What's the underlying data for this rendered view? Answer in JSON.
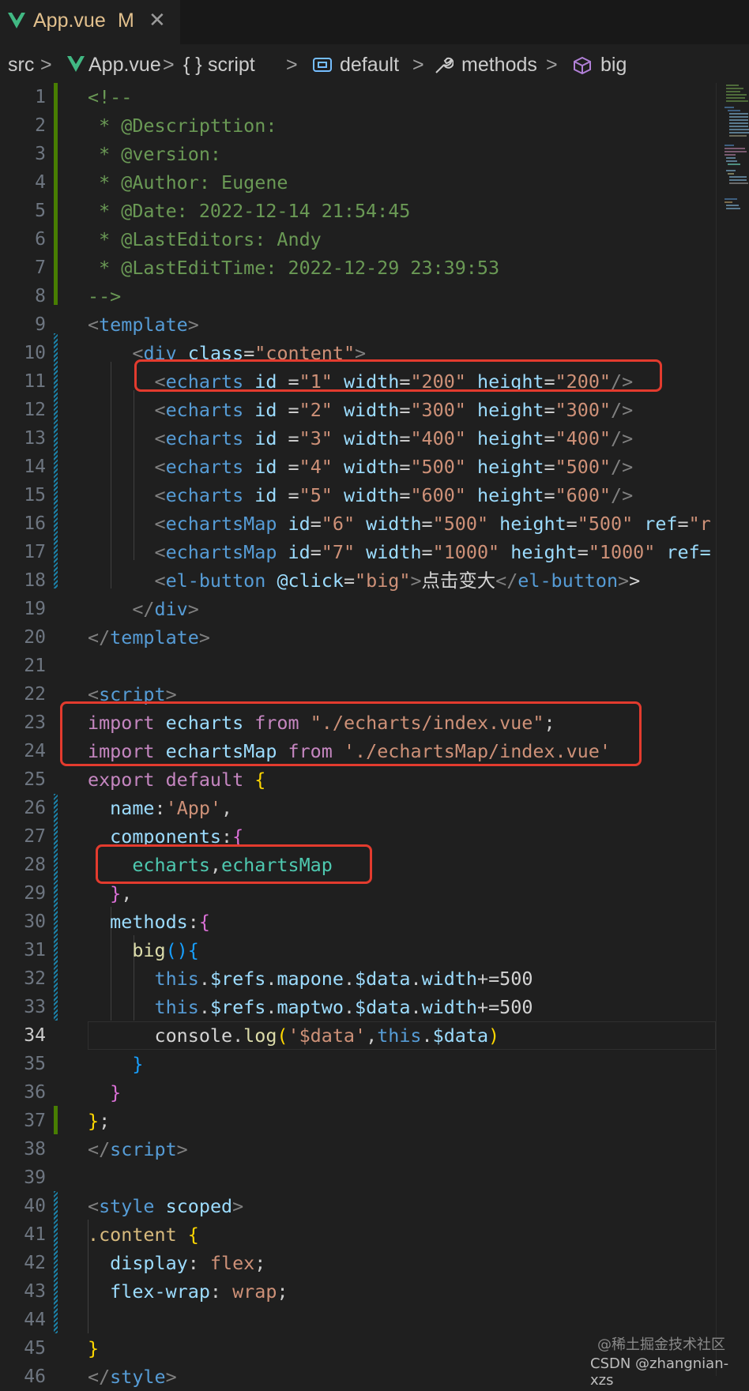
{
  "tab": {
    "filename": "App.vue",
    "status": "M",
    "close": "✕"
  },
  "breadcrumb": {
    "src": "src",
    "file": "App.vue",
    "script_glyph": "{ }",
    "script": "script",
    "default": "default",
    "methods": "methods",
    "big": "big",
    "sep": ">"
  },
  "lines": {
    "l1": "<!--",
    "l2": " * @Descripttion:",
    "l3": " * @version:",
    "l4": " * @Author: Eugene",
    "l5": " * @Date: 2022-12-14 21:54:45",
    "l6": " * @LastEditors: Andy",
    "l7": " * @LastEditTime: 2022-12-29 23:39:53",
    "l8": "-->",
    "l10_id": "\"content\"",
    "e1": {
      "id": "\"1\"",
      "w": "\"200\"",
      "h": "\"200\""
    },
    "e2": {
      "id": "\"2\"",
      "w": "\"300\"",
      "h": "\"300\""
    },
    "e3": {
      "id": "\"3\"",
      "w": "\"400\"",
      "h": "\"400\""
    },
    "e4": {
      "id": "\"4\"",
      "w": "\"500\"",
      "h": "\"500\""
    },
    "e5": {
      "id": "\"5\"",
      "w": "\"600\"",
      "h": "\"600\""
    },
    "m6": {
      "id": "\"6\"",
      "w": "\"500\"",
      "h": "\"500\"",
      "ref": "\"r"
    },
    "m7": {
      "id": "\"7\"",
      "w": "\"1000\"",
      "h": "\"1000\"",
      "ref": "ref="
    },
    "l18_click": "\"big\"",
    "l18_text": "点击变大",
    "l23_path": "\"./echarts/index.vue\"",
    "l24_path": "'./echartsMap/index.vue'",
    "l26_name": "'App'",
    "l32": "mapone",
    "l33": "maptwo",
    "l34_arg": "'$data'"
  },
  "watermark": {
    "juejin": "@稀土掘金技术社区",
    "csdn": "CSDN @zhangnian-xzs"
  },
  "colors": {
    "background": "#1f1f1f",
    "highlight_box": "#e33b2e",
    "git_added": "#487e02",
    "git_modified": "#1b81a8"
  }
}
